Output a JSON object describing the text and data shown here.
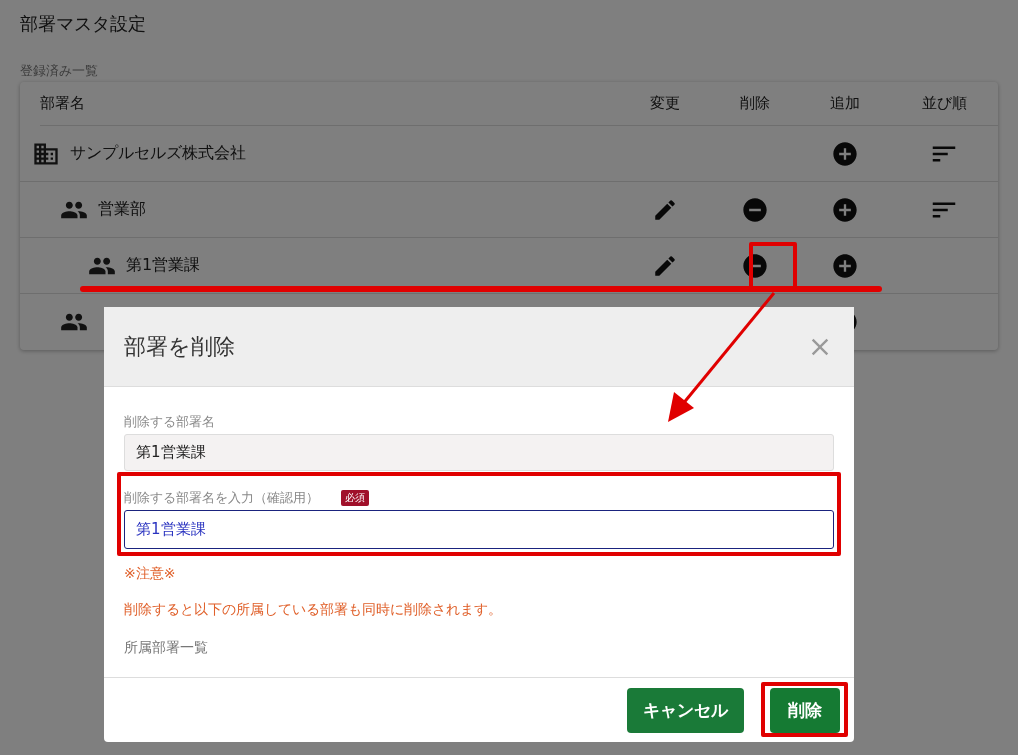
{
  "page": {
    "title": "部署マスタ設定",
    "section_label": "登録済み一覧"
  },
  "table": {
    "columns": [
      "部署名",
      "変更",
      "削除",
      "追加",
      "並び順"
    ],
    "rows": [
      {
        "name": "サンプルセルズ株式会社",
        "kind": "company",
        "can_edit": false,
        "can_delete": false,
        "can_add": true,
        "can_sort": true,
        "underlined": false,
        "delete_highlighted": false,
        "children": [
          {
            "name": "営業部",
            "kind": "group",
            "can_edit": true,
            "can_delete": true,
            "can_add": true,
            "can_sort": true,
            "underlined": false,
            "delete_highlighted": false,
            "children": [
              {
                "name": "第1営業課",
                "kind": "group",
                "can_edit": true,
                "can_delete": true,
                "can_add": true,
                "can_sort": false,
                "underlined": true,
                "delete_highlighted": true
              }
            ]
          },
          {
            "kind": "group",
            "can_add": true,
            "can_sort": false,
            "underlined": false,
            "delete_highlighted": false
          }
        ]
      }
    ]
  },
  "dialog": {
    "title": "部署を削除",
    "target_label": "削除する部署名",
    "target_value": "第1営業課",
    "confirm_label": "削除する部署名を入力（確認用）",
    "required_badge": "必須",
    "confirm_value": "第1営業課",
    "confirm_highlighted": true,
    "warning_title": "※注意※",
    "warning_text": "削除すると以下の所属している部署も同時に削除されます。",
    "children_label": "所属部署一覧",
    "buttons": [
      {
        "label": "キャンセル",
        "kind": "cancel",
        "highlighted": false
      },
      {
        "label": "削除",
        "kind": "delete",
        "highlighted": true
      }
    ]
  }
}
